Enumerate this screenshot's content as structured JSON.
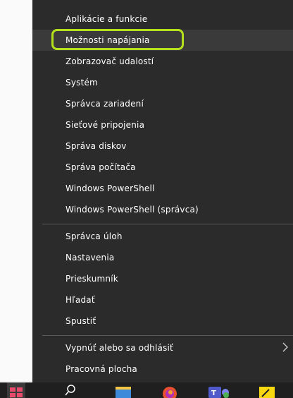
{
  "menu": {
    "group1": [
      {
        "label": "Aplikácie a funkcie"
      },
      {
        "label": "Možnosti napájania"
      },
      {
        "label": "Zobrazovač udalostí"
      },
      {
        "label": "Systém"
      },
      {
        "label": "Správca zariadení"
      },
      {
        "label": "Sieťové pripojenia"
      },
      {
        "label": "Správa diskov"
      },
      {
        "label": "Správa počítača"
      },
      {
        "label": "Windows PowerShell"
      },
      {
        "label": "Windows PowerShell (správca)"
      }
    ],
    "group2": [
      {
        "label": "Správca úloh"
      },
      {
        "label": "Nastavenia"
      },
      {
        "label": "Prieskumník"
      },
      {
        "label": "Hľadať"
      },
      {
        "label": "Spustiť"
      }
    ],
    "group3": [
      {
        "label": "Vypnúť alebo sa odhlásiť"
      },
      {
        "label": "Pracovná plocha"
      }
    ]
  },
  "highlight_color": "#b6e01c",
  "taskbar": {
    "icons": [
      "windows-start-icon",
      "search-icon",
      "file-explorer-icon",
      "firefox-icon",
      "teams-icon",
      "sticky-notes-icon"
    ]
  }
}
